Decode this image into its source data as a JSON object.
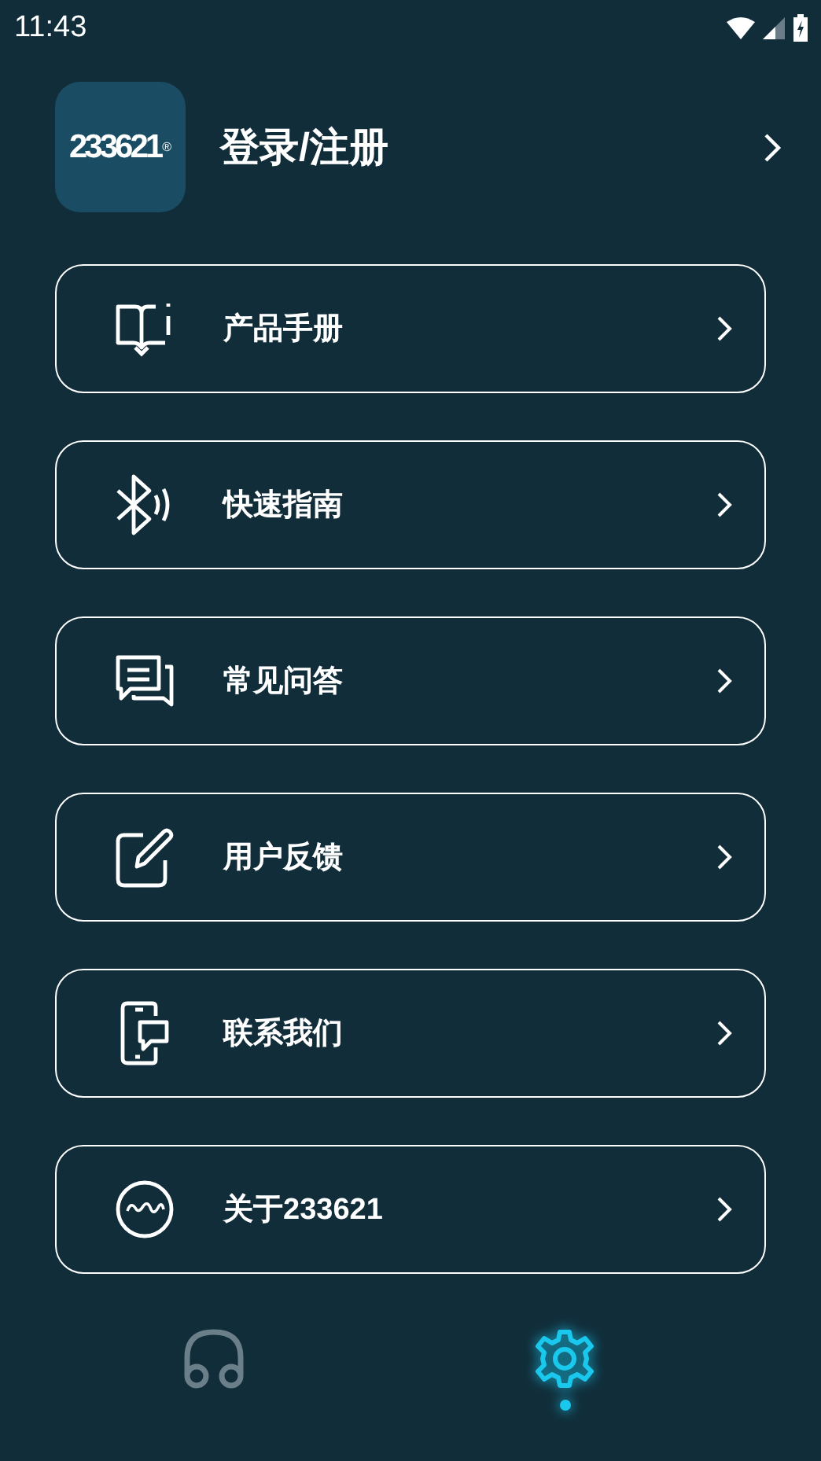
{
  "status_bar": {
    "time": "11:43"
  },
  "profile": {
    "logo_text": "233621",
    "logo_mark": "®",
    "title": "登录/注册"
  },
  "menu": [
    {
      "kind": "manual",
      "label": "产品手册"
    },
    {
      "kind": "guide",
      "label": "快速指南"
    },
    {
      "kind": "faq",
      "label": "常见问答"
    },
    {
      "kind": "feedback",
      "label": "用户反馈"
    },
    {
      "kind": "contact",
      "label": "联系我们"
    },
    {
      "kind": "about",
      "label": "关于233621"
    }
  ],
  "bottom_nav": [
    {
      "kind": "headphones",
      "selected": false
    },
    {
      "kind": "settings",
      "selected": true
    }
  ]
}
